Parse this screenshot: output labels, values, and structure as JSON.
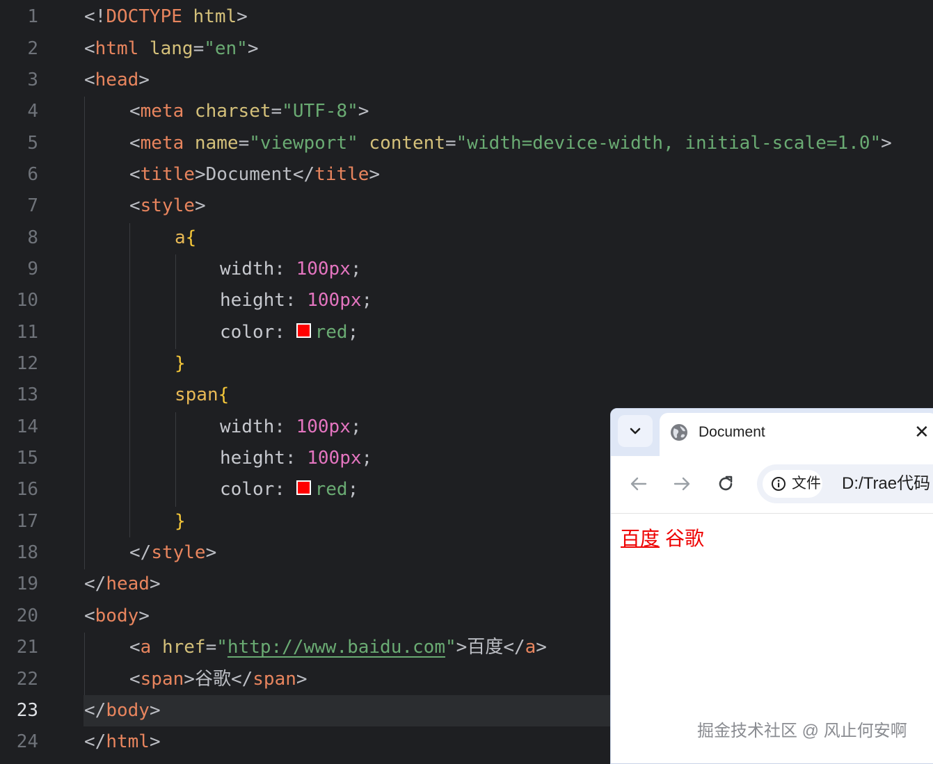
{
  "editor": {
    "active_line": 23,
    "lines": [
      {
        "n": "1"
      },
      {
        "n": "2"
      },
      {
        "n": "3"
      },
      {
        "n": "4"
      },
      {
        "n": "5"
      },
      {
        "n": "6"
      },
      {
        "n": "7"
      },
      {
        "n": "8"
      },
      {
        "n": "9"
      },
      {
        "n": "10"
      },
      {
        "n": "11"
      },
      {
        "n": "12"
      },
      {
        "n": "13"
      },
      {
        "n": "14"
      },
      {
        "n": "15"
      },
      {
        "n": "16"
      },
      {
        "n": "17"
      },
      {
        "n": "18"
      },
      {
        "n": "19"
      },
      {
        "n": "20"
      },
      {
        "n": "21"
      },
      {
        "n": "22"
      },
      {
        "n": "23"
      },
      {
        "n": "24"
      }
    ],
    "code": {
      "l1": [
        "<!",
        "DOCTYPE",
        " html",
        ">"
      ],
      "l2": [
        "<",
        "html",
        " lang",
        "=",
        "\"en\"",
        ">"
      ],
      "l3": [
        "<",
        "head",
        ">"
      ],
      "l4": [
        "<",
        "meta",
        " charset",
        "=",
        "\"UTF-8\"",
        ">"
      ],
      "l5": [
        "<",
        "meta",
        " name",
        "=",
        "\"viewport\"",
        " content",
        "=",
        "\"width=device-width, initial-scale=1.0\"",
        ">"
      ],
      "l6": [
        "<",
        "title",
        ">",
        "Document",
        "</",
        "title",
        ">"
      ],
      "l7": [
        "<",
        "style",
        ">"
      ],
      "l8": [
        "a",
        "{"
      ],
      "l9": [
        "width",
        ": ",
        "100px",
        ";"
      ],
      "l10": [
        "height",
        ": ",
        "100px",
        ";"
      ],
      "l11": [
        "color",
        ": ",
        "red",
        ";"
      ],
      "l12": [
        "}"
      ],
      "l13": [
        "span",
        "{"
      ],
      "l14": [
        "width",
        ": ",
        "100px",
        ";"
      ],
      "l15": [
        "height",
        ": ",
        "100px",
        ";"
      ],
      "l16": [
        "color",
        ": ",
        "red",
        ";"
      ],
      "l17": [
        "}"
      ],
      "l18": [
        "</",
        "style",
        ">"
      ],
      "l19": [
        "</",
        "head",
        ">"
      ],
      "l20": [
        "<",
        "body",
        ">"
      ],
      "l21": [
        "<",
        "a",
        " href",
        "=",
        "\"",
        "http://www.baidu.com",
        "\"",
        ">",
        "百度",
        "</",
        "a",
        ">"
      ],
      "l22": [
        "<",
        "span",
        ">",
        "谷歌",
        "</",
        "span",
        ">"
      ],
      "l23": [
        "</",
        "body",
        ">"
      ],
      "l24": [
        "</",
        "html",
        ">"
      ]
    },
    "swatch_color": "#ff0000"
  },
  "browser": {
    "tab_title": "Document",
    "tab_close": "✕",
    "chip_label": "文件",
    "url": "D:/Trae代码",
    "links": {
      "baidu": "百度",
      "google": "谷歌"
    },
    "link_color": "#ee0000"
  },
  "watermark": "掘金技术社区 @ 风止何安啊"
}
